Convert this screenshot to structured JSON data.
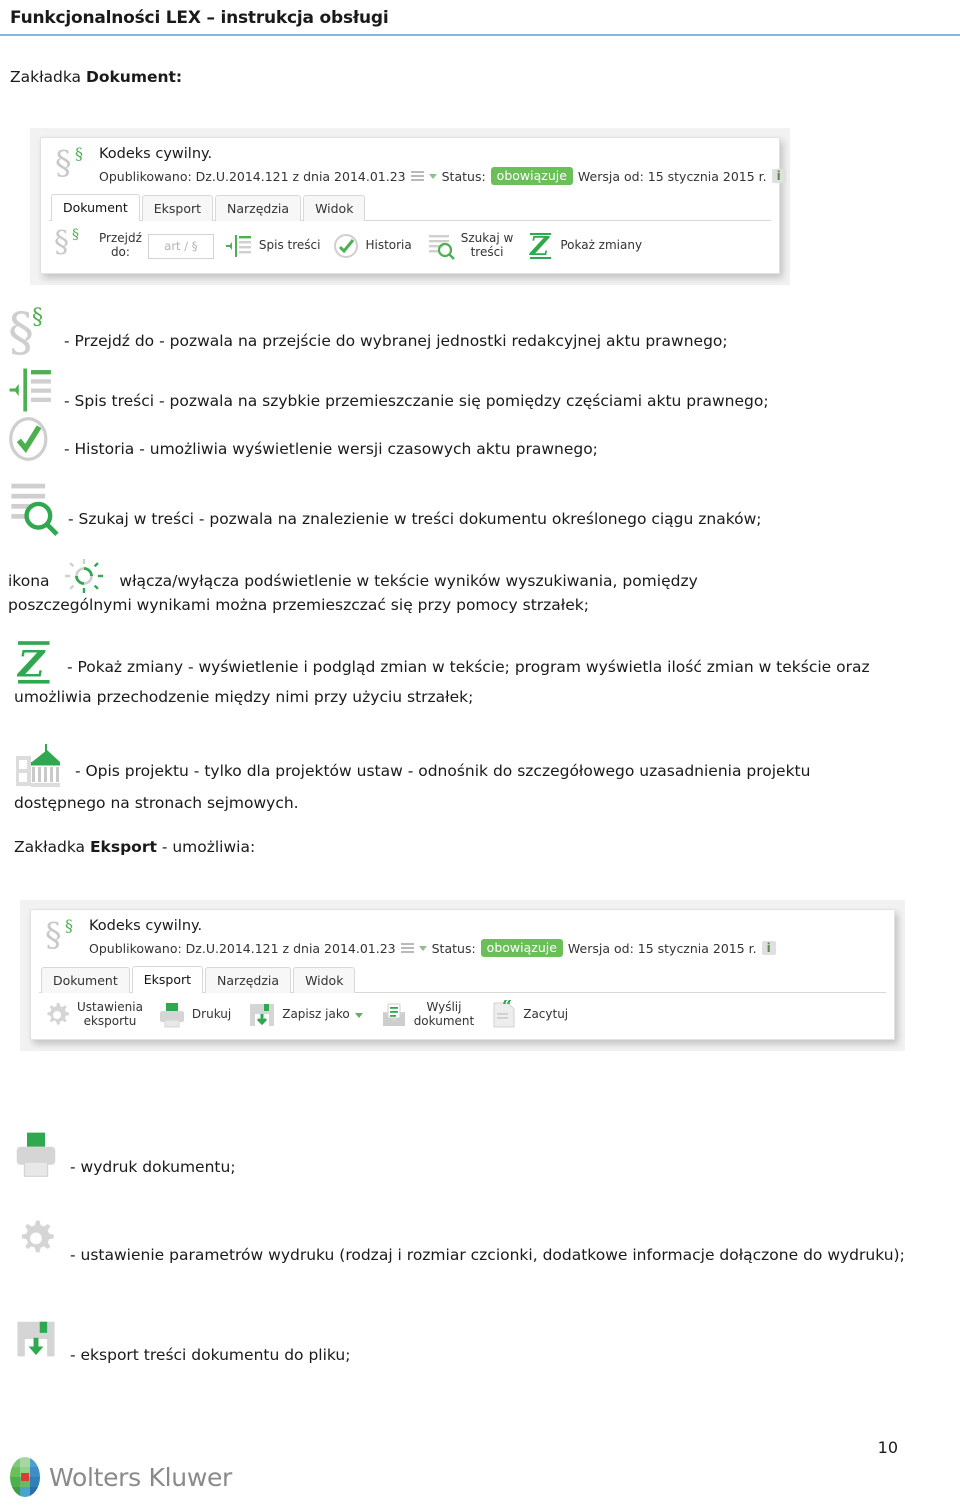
{
  "header": {
    "title": "Funkcjonalności LEX – instrukcja obsługi",
    "rule_color": "#8fb4d9"
  },
  "colors": {
    "accent_green": "#4caf50",
    "badge_green": "#6bbf59",
    "icon_grey": "#c9c9c9",
    "text": "#1a1a1a"
  },
  "sections": {
    "dokument_heading_prefix": "Zakładka ",
    "dokument_heading_bold": "Dokument:",
    "eksport_heading_prefix": "Zakładka ",
    "eksport_heading_bold": "Eksport",
    "eksport_heading_suffix": " - umożliwia:"
  },
  "screenshot_dokument": {
    "doc_title": "Kodeks cywilny.",
    "meta": {
      "published_label": "Opublikowano: Dz.U.2014.121 z dnia 2014.01.23",
      "status_label": "Status:",
      "status_value": "obowiązuje",
      "version_label": "Wersja od: 15 stycznia 2015 r.",
      "info_badge": "i"
    },
    "tabs": [
      {
        "label": "Dokument",
        "active": true
      },
      {
        "label": "Eksport",
        "active": false
      },
      {
        "label": "Narzędzia",
        "active": false
      },
      {
        "label": "Widok",
        "active": false
      }
    ],
    "toolbar": [
      {
        "icon": "paragraph-icon",
        "label": "Przejdź\ndo:",
        "label_line1": "Przejdź",
        "label_line2": "do:"
      },
      {
        "icon": "text-input",
        "value": "",
        "placeholder": "art / §"
      },
      {
        "icon": "table-of-contents-icon",
        "label": "Spis treści"
      },
      {
        "icon": "history-check-icon",
        "label": "Historia"
      },
      {
        "icon": "search-in-text-icon",
        "label_line1": "Szukaj w",
        "label_line2": "treści"
      },
      {
        "icon": "show-changes-z-icon",
        "label": "Pokaż zmiany"
      }
    ]
  },
  "dokument_items": [
    {
      "icon": "paragraph-icon",
      "text": "- Przejdź do - pozwala na przejście do wybranej jednostki redakcyjnej aktu prawnego;"
    },
    {
      "icon": "table-of-contents-icon",
      "text": "- Spis treści - pozwala na szybkie przemieszczanie się pomiędzy częściami aktu prawnego;"
    },
    {
      "icon": "history-check-icon",
      "text": "- Historia - umożliwia wyświetlenie wersji czasowych aktu prawnego;"
    },
    {
      "icon": "search-in-text-icon",
      "text": "- Szukaj w treści - pozwala na znalezienie w treści dokumentu określonego ciągu znaków;"
    }
  ],
  "highlight_paragraph": {
    "prefix": "ikona",
    "icon": "highlight-sun-icon",
    "text": "włącza/wyłącza podświetlenie w tekście wyników wyszukiwania, pomiędzy poszczególnymi wynikami można przemieszczać się przy pomocy strzałek;"
  },
  "show_changes_paragraph": {
    "icon": "show-changes-z-icon",
    "text": "- Pokaż zmiany - wyświetlenie i podgląd zmian w tekście; program wyświetla ilość zmian w tekście oraz umożliwia przechodzenie między nimi przy użyciu strzałek;"
  },
  "project_description_paragraph": {
    "icon": "parliament-building-icon",
    "text": "- Opis projektu - tylko dla projektów ustaw - odnośnik do szczegółowego uzasadnienia projektu dostępnego na stronach sejmowych."
  },
  "screenshot_eksport": {
    "doc_title": "Kodeks cywilny.",
    "meta": {
      "published_label": "Opublikowano: Dz.U.2014.121 z dnia 2014.01.23",
      "status_label": "Status:",
      "status_value": "obowiązuje",
      "version_label": "Wersja od: 15 stycznia 2015 r.",
      "info_badge": "i"
    },
    "tabs": [
      {
        "label": "Dokument",
        "active": false
      },
      {
        "label": "Eksport",
        "active": true
      },
      {
        "label": "Narzędzia",
        "active": false
      },
      {
        "label": "Widok",
        "active": false
      }
    ],
    "toolbar": [
      {
        "icon": "gear-icon",
        "label_line1": "Ustawienia",
        "label_line2": "eksportu"
      },
      {
        "icon": "printer-icon",
        "label": "Drukuj"
      },
      {
        "icon": "save-as-icon",
        "label": "Zapisz jako",
        "has_chevron": true
      },
      {
        "icon": "send-envelope-icon",
        "label_line1": "Wyślij",
        "label_line2": "dokument"
      },
      {
        "icon": "quote-icon",
        "label": "Zacytuj"
      }
    ]
  },
  "eksport_items": [
    {
      "icon": "printer-icon",
      "text": "- wydruk dokumentu;"
    },
    {
      "icon": "gear-icon",
      "text": "- ustawienie parametrów wydruku (rodzaj i rozmiar czcionki, dodatkowe informacje dołączone do wydruku);"
    },
    {
      "icon": "save-as-icon",
      "text": "- eksport treści dokumentu do pliku;"
    }
  ],
  "footer": {
    "page_number": "10",
    "brand": "Wolters Kluwer",
    "logo_icon": "wolters-kluwer-logo"
  }
}
